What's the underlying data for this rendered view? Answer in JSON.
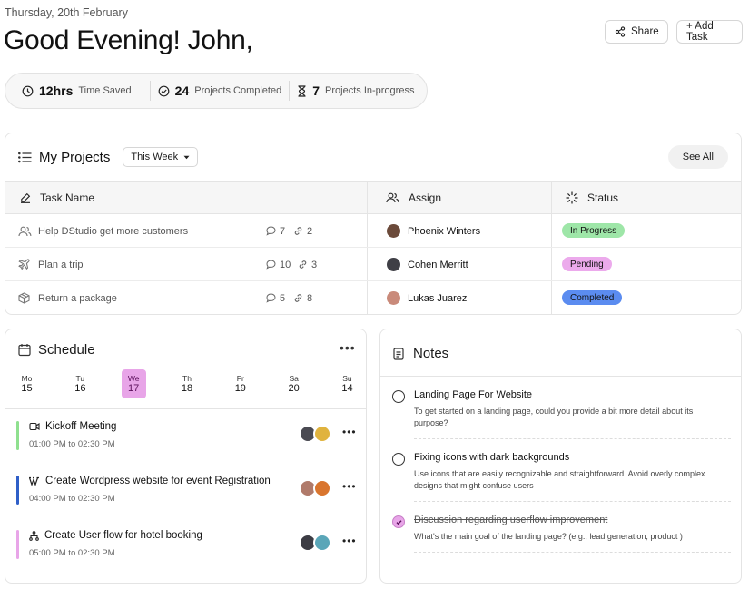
{
  "header": {
    "date": "Thursday, 20th February",
    "greeting": "Good Evening! John,",
    "share_label": "Share",
    "add_task_label": "+ Add Task"
  },
  "stats": [
    {
      "icon": "clock-icon",
      "value": "12hrs",
      "label": "Time Saved"
    },
    {
      "icon": "check-circle-icon",
      "value": "24",
      "label": "Projects Completed"
    },
    {
      "icon": "hourglass-icon",
      "value": "7",
      "label": "Projects In-progress"
    }
  ],
  "projects": {
    "title": "My Projects",
    "filter": "This Week",
    "see_all": "See All",
    "columns": {
      "task": "Task Name",
      "assign": "Assign",
      "status": "Status"
    },
    "rows": [
      {
        "icon": "users-icon",
        "task": "Help DStudio get more customers",
        "comments": "7",
        "links": "2",
        "assignee": "Phoenix Winters",
        "status": "In Progress",
        "status_color": "#9ee6a8"
      },
      {
        "icon": "plane-icon",
        "task": "Plan a trip",
        "comments": "10",
        "links": "3",
        "assignee": "Cohen Merritt",
        "status": "Pending",
        "status_color": "#ecaaec"
      },
      {
        "icon": "package-icon",
        "task": "Return a package",
        "comments": "5",
        "links": "8",
        "assignee": "Lukas Juarez",
        "status": "Completed",
        "status_color": "#5b8cf0"
      }
    ]
  },
  "schedule": {
    "title": "Schedule",
    "days": [
      {
        "name": "Mo",
        "num": "15"
      },
      {
        "name": "Tu",
        "num": "16"
      },
      {
        "name": "We",
        "num": "17",
        "active": true
      },
      {
        "name": "Th",
        "num": "18"
      },
      {
        "name": "Fr",
        "num": "19"
      },
      {
        "name": "Sa",
        "num": "20"
      },
      {
        "name": "Su",
        "num": "14"
      }
    ],
    "events": [
      {
        "icon": "video-icon",
        "title": "Kickoff Meeting",
        "time": "01:00 PM to 02:30 PM",
        "color": "#8fe08f"
      },
      {
        "icon": "wordpress-icon",
        "title": "Create Wordpress website for event Registration",
        "time": "04:00 PM to 02:30 PM",
        "color": "#2f5fc8"
      },
      {
        "icon": "flow-icon",
        "title": "Create User flow for hotel booking",
        "time": "05:00 PM to 02:30 PM",
        "color": "#e8a5e8"
      }
    ]
  },
  "notes": {
    "title": "Notes",
    "items": [
      {
        "title": "Landing Page For Website",
        "body": "To get started on a landing page, could you provide a bit more detail about its purpose?",
        "done": false
      },
      {
        "title": "Fixing icons with dark backgrounds",
        "body": "Use icons that are easily recognizable and straightforward. Avoid overly complex designs that might confuse users",
        "done": false
      },
      {
        "title": "Discussion regarding userflow improvement",
        "body": "What's the main goal of the landing page? (e.g., lead generation, product )",
        "done": true
      }
    ]
  }
}
